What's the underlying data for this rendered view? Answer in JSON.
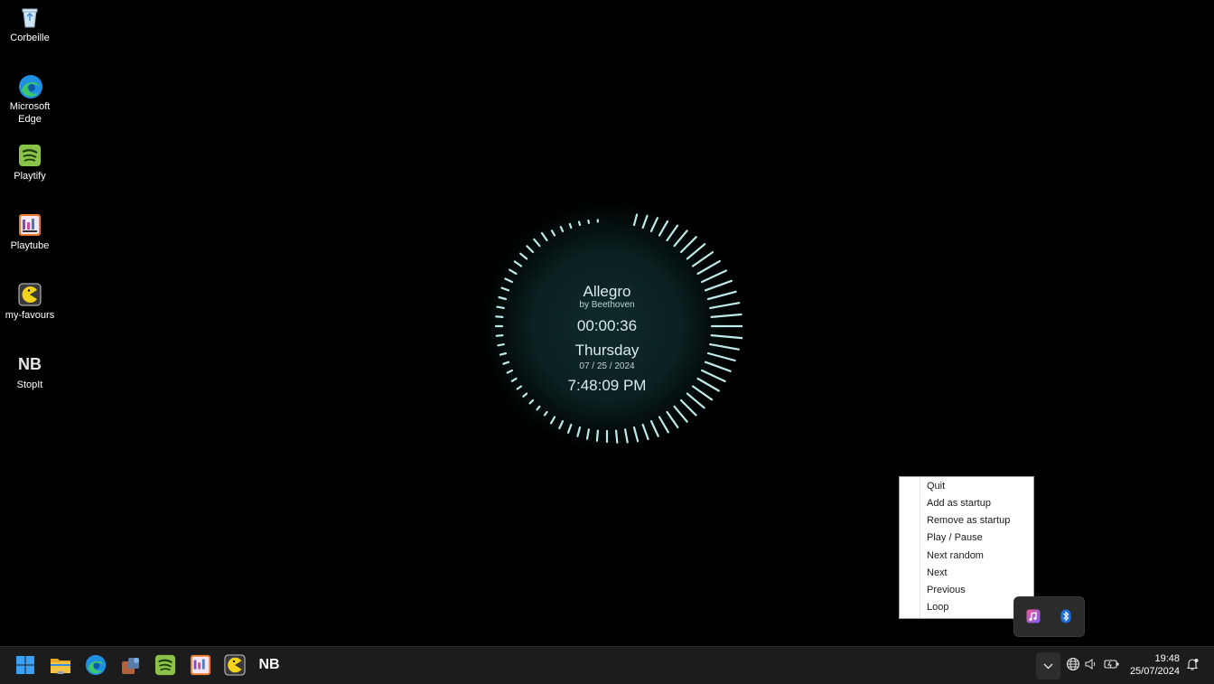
{
  "desktop": {
    "icons": [
      {
        "label": "Corbeille",
        "icon": "recycle-bin-icon"
      },
      {
        "label": "Microsoft Edge",
        "icon": "edge-icon"
      },
      {
        "label": "Playtify",
        "icon": "playtify-icon"
      },
      {
        "label": "Playtube",
        "icon": "playtube-icon"
      },
      {
        "label": "my-favours",
        "icon": "pacman-icon"
      },
      {
        "label": "StopIt",
        "icon": "nb-icon",
        "glyph_text": "NB"
      }
    ]
  },
  "widget": {
    "title": "Allegro",
    "artist": "by Beethoven",
    "elapsed": "00:00:36",
    "day": "Thursday",
    "date": "07 / 25 / 2024",
    "time": "7:48:09 PM",
    "accent": "#bfeaea"
  },
  "context_menu": {
    "items": [
      "Quit",
      "Add as startup",
      "Remove as startup",
      "Play / Pause",
      "Next random",
      "Next",
      "Previous",
      "Loop"
    ]
  },
  "tray_overflow": {
    "icons": [
      "music-player-icon",
      "bluetooth-icon"
    ]
  },
  "taskbar": {
    "apps": [
      "start-icon",
      "file-explorer-icon",
      "edge-icon",
      "weather-app-icon",
      "playtify-icon",
      "playtube-icon",
      "pacman-icon",
      "nb-icon"
    ],
    "nb_text": "NB",
    "tray_icons": [
      "chevron-up-icon",
      "network-globe-icon",
      "volume-icon",
      "battery-icon",
      "notification-icon"
    ],
    "clock_time": "19:48",
    "clock_date": "25/07/2024"
  },
  "colors": {
    "taskbar": "#1c1c1c",
    "desktop": "#000000",
    "explorer_yellow": "#f6c444",
    "edge_blue": "#1f8fe0",
    "spotify_green": "#8bc34a"
  }
}
